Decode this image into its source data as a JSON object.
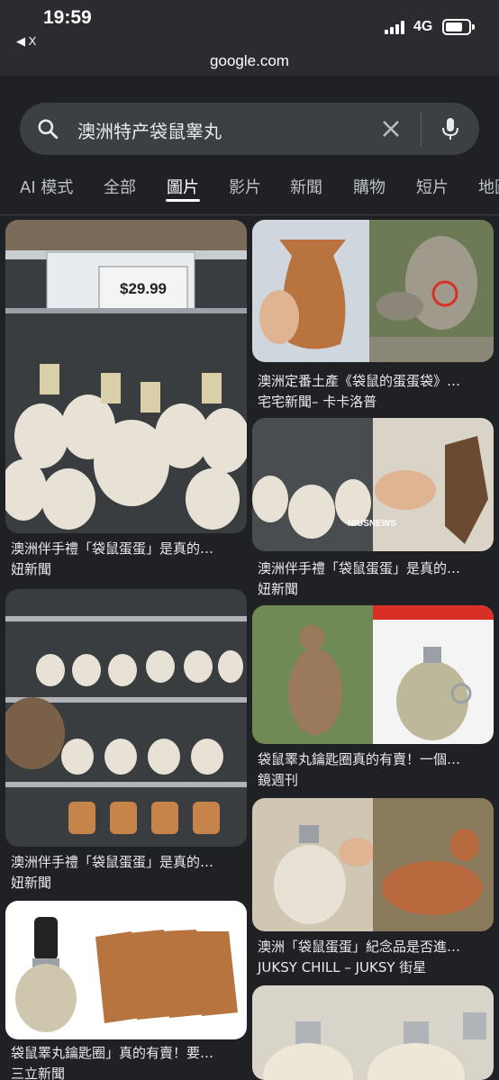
{
  "status": {
    "time": "19:59",
    "back_label": "◀ X",
    "network": "4G",
    "url": "google.com"
  },
  "search": {
    "query": "澳洲特产袋鼠睾丸"
  },
  "tabs": [
    {
      "label": "AI 模式"
    },
    {
      "label": "全部"
    },
    {
      "label": "圖片"
    },
    {
      "label": "影片"
    },
    {
      "label": "新聞"
    },
    {
      "label": "購物"
    },
    {
      "label": "短片"
    },
    {
      "label": "地圖"
    }
  ],
  "results": [
    {
      "caption": "澳洲伴手禮「袋鼠蛋蛋」是真的…",
      "source": "妞新聞",
      "price_tag": "$29.99"
    },
    {
      "caption": "澳洲定番土產《袋鼠的蛋蛋袋》…",
      "source": "宅宅新聞– 卡卡洛普"
    },
    {
      "caption": "澳洲伴手禮「袋鼠蛋蛋」是真的…",
      "source": "妞新聞",
      "watermark": "NIUSNEWS"
    },
    {
      "caption": "澳洲伴手禮「袋鼠蛋蛋」是真的…",
      "source": "妞新聞"
    },
    {
      "caption": "袋鼠睪丸鑰匙圈真的有賣！一個…",
      "source": "鏡週刊"
    },
    {
      "caption": "澳洲「袋鼠蛋蛋」紀念品是否進…",
      "source": "JUKSY CHILL – JUKSY 街星"
    },
    {
      "caption": "袋鼠睪丸鑰匙圈」真的有賣！要…",
      "source": "三立新聞"
    }
  ],
  "colors": {
    "background": "#202124",
    "search_bg": "#3c4043",
    "text": "#e8eaed"
  }
}
